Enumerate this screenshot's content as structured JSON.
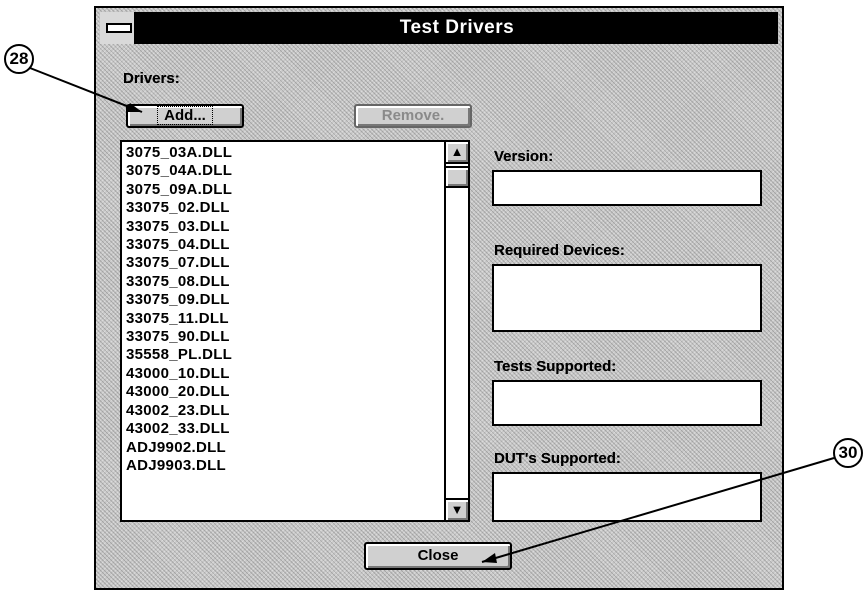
{
  "window": {
    "title": "Test Drivers"
  },
  "drivers_label": "Drivers:",
  "buttons": {
    "add": "Add...",
    "remove": "Remove.",
    "close": "Close"
  },
  "drivers": [
    "3075_03A.DLL",
    "3075_04A.DLL",
    "3075_09A.DLL",
    "33075_02.DLL",
    "33075_03.DLL",
    "33075_04.DLL",
    "33075_07.DLL",
    "33075_08.DLL",
    "33075_09.DLL",
    "33075_11.DLL",
    "33075_90.DLL",
    "35558_PL.DLL",
    "43000_10.DLL",
    "43000_20.DLL",
    "43002_23.DLL",
    "43002_33.DLL",
    "ADJ9902.DLL",
    "ADJ9903.DLL"
  ],
  "fields": {
    "version_label": "Version:",
    "required_devices_label": "Required Devices:",
    "tests_supported_label": "Tests Supported:",
    "duts_supported_label": "DUT's Supported:"
  },
  "callouts": {
    "a": "28",
    "b": "30"
  }
}
